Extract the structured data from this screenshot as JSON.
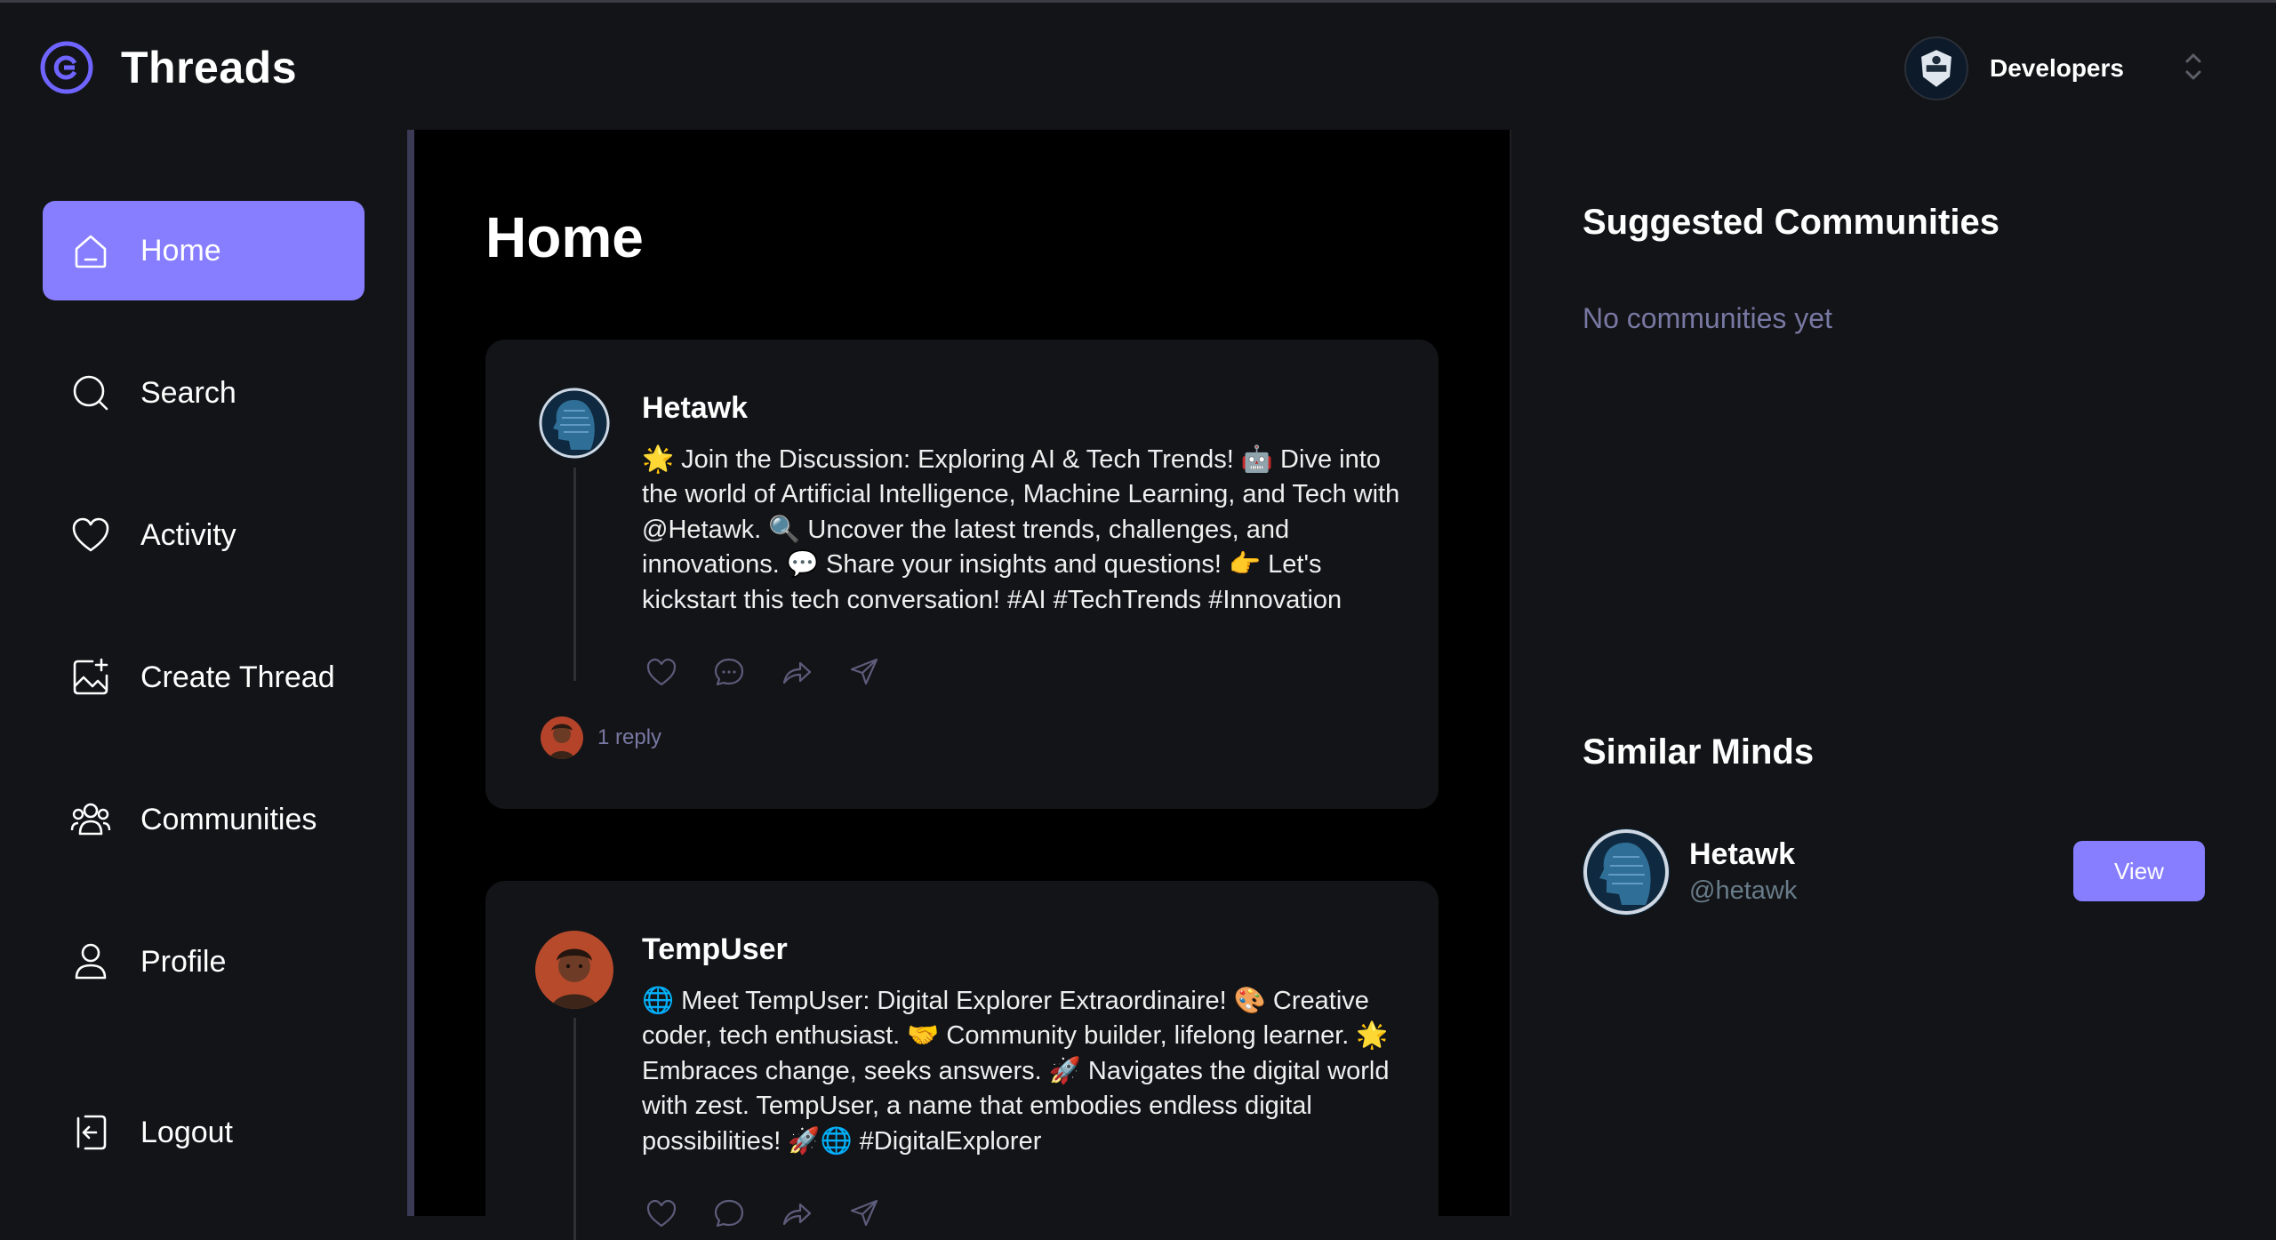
{
  "header": {
    "app_name": "Threads",
    "org_name": "Developers"
  },
  "sidebar": {
    "items": [
      {
        "label": "Home"
      },
      {
        "label": "Search"
      },
      {
        "label": "Activity"
      },
      {
        "label": "Create Thread"
      },
      {
        "label": "Communities"
      },
      {
        "label": "Profile"
      }
    ],
    "logout_label": "Logout"
  },
  "main": {
    "title": "Home",
    "posts": [
      {
        "author": "Hetawk",
        "content": "🌟 Join the Discussion: Exploring AI & Tech Trends! 🤖 Dive into the world of Artificial Intelligence, Machine Learning, and Tech with @Hetawk. 🔍 Uncover the latest trends, challenges, and innovations. 💬 Share your insights and questions! 👉 Let's kickstart this tech conversation! #AI #TechTrends #Innovation",
        "replies": "1 reply"
      },
      {
        "author": "TempUser",
        "content": "🌐 Meet TempUser: Digital Explorer Extraordinaire! 🎨 Creative coder, tech enthusiast. 🤝 Community builder, lifelong learner. 🌟 Embraces change, seeks answers. 🚀 Navigates the digital world with zest. TempUser, a name that embodies endless digital possibilities! 🚀🌐 #DigitalExplorer"
      }
    ]
  },
  "right": {
    "suggested_title": "Suggested Communities",
    "suggested_empty": "No communities yet",
    "similar_title": "Similar Minds",
    "similar_users": [
      {
        "name": "Hetawk",
        "handle": "@hetawk",
        "button": "View"
      }
    ]
  },
  "colors": {
    "accent": "#877eff",
    "bg_dark": "#121417",
    "bg_black": "#000000",
    "muted_text": "#7878a3"
  }
}
